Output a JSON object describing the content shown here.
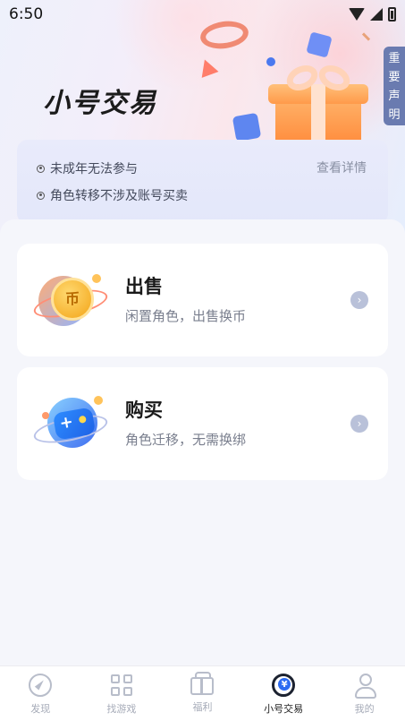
{
  "status_bar": {
    "time": "6:50"
  },
  "header": {
    "title": "小号交易"
  },
  "side_tag": {
    "chars": [
      "重",
      "要",
      "声",
      "明"
    ]
  },
  "notice": {
    "items": [
      "未成年无法参与",
      "角色转移不涉及账号买卖"
    ],
    "detail_link": "查看详情"
  },
  "cards": [
    {
      "title": "出售",
      "subtitle": "闲置角色，出售换币",
      "icon": "coin-icon",
      "coin_char": "币"
    },
    {
      "title": "购买",
      "subtitle": "角色迁移，无需换绑",
      "icon": "gamepad-icon"
    }
  ],
  "bottom_nav": {
    "items": [
      {
        "label": "发现",
        "icon": "compass-icon",
        "active": false
      },
      {
        "label": "找游戏",
        "icon": "grid-icon",
        "active": false
      },
      {
        "label": "福利",
        "icon": "gift-icon",
        "active": false
      },
      {
        "label": "小号交易",
        "icon": "trade-icon",
        "active": true
      },
      {
        "label": "我的",
        "icon": "user-icon",
        "active": false
      }
    ]
  },
  "colors": {
    "accent_blue": "#2d6cf2",
    "side_tag_bg": "#6a7bb0",
    "coin_gold": "#f3a417"
  }
}
